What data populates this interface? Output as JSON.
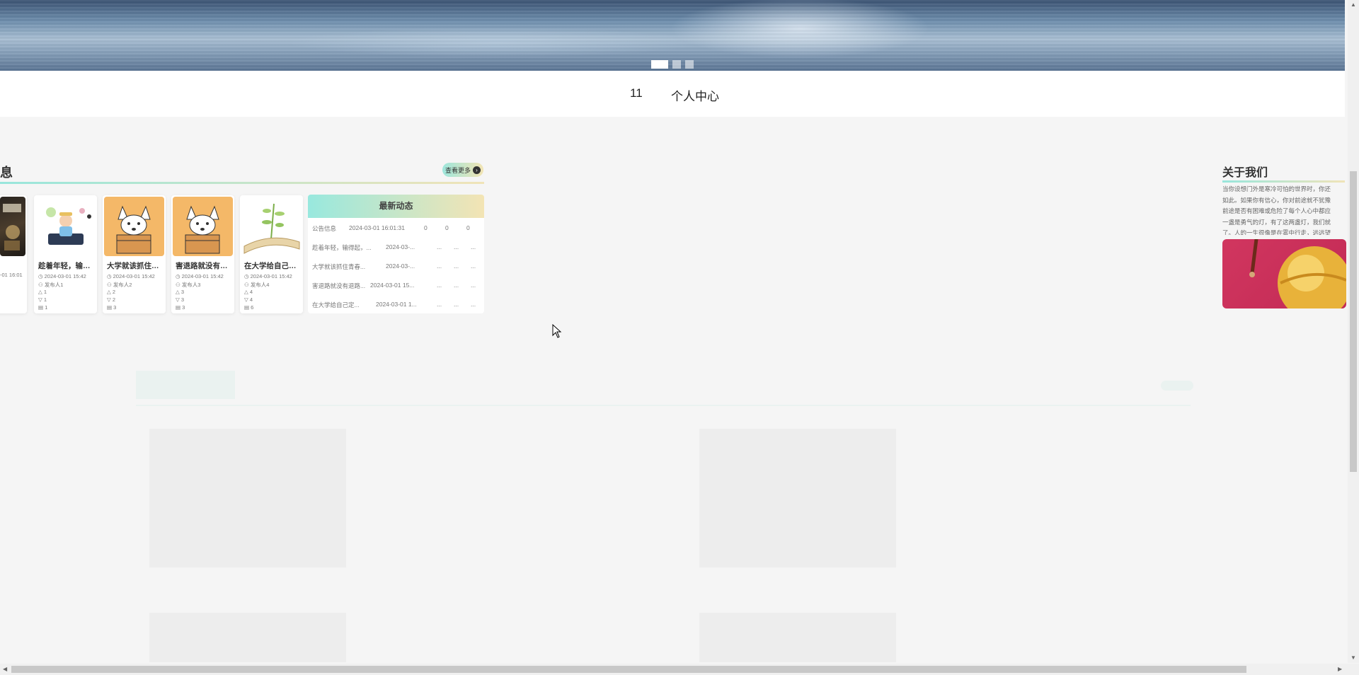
{
  "banner": {
    "slides": [
      "slide-1",
      "slide-2",
      "slide-3"
    ],
    "active_slide": 0
  },
  "nav": {
    "items": [
      {
        "label": "11"
      },
      {
        "label": "个人中心"
      }
    ]
  },
  "info_section": {
    "title": "息",
    "more_label": "查看更多",
    "cards": [
      {
        "title": "",
        "date": "-01 16:01",
        "author": "",
        "likes": "",
        "dislikes": "",
        "comments": ""
      },
      {
        "title": "趁着年轻，输得起，...",
        "date": "2024-03-01 15:42",
        "author": "发布人1",
        "likes": "1",
        "dislikes": "1",
        "comments": "1"
      },
      {
        "title": "大学就该抓住青春...",
        "date": "2024-03-01 15:42",
        "author": "发布人2",
        "likes": "2",
        "dislikes": "2",
        "comments": "3"
      },
      {
        "title": "害退路就没有退路...",
        "date": "2024-03-01 15:42",
        "author": "发布人3",
        "likes": "3",
        "dislikes": "3",
        "comments": "3"
      },
      {
        "title": "在大学给自己定...",
        "date": "2024-03-01 15:42",
        "author": "发布人4",
        "likes": "4",
        "dislikes": "4",
        "comments": "6"
      }
    ]
  },
  "latest": {
    "title": "最新动态",
    "rows": [
      {
        "title": "公告信息",
        "time": "2024-03-01 16:01:31",
        "likes": "0",
        "dislikes": "0",
        "comments": "0"
      },
      {
        "title": "趁着年轻，输得起，...",
        "time": "2024-03-...",
        "likes": "...",
        "dislikes": "...",
        "comments": "..."
      },
      {
        "title": "大学就该抓住青春...",
        "time": "2024-03-...",
        "likes": "...",
        "dislikes": "...",
        "comments": "..."
      },
      {
        "title": "害退路就没有退路...",
        "time": "2024-03-01 15...",
        "likes": "...",
        "dislikes": "...",
        "comments": "..."
      },
      {
        "title": "在大学给自己定...",
        "time": "2024-03-01 1...",
        "likes": "...",
        "dislikes": "...",
        "comments": "..."
      }
    ]
  },
  "about": {
    "title": "关于我们",
    "text": "当你设想门外是寒冷可怕的世界时，你还\n如此。如果你有信心，你对前途就不犹豫\n前途是否有困难或危险了每个人心中都应\n一盏是勇气的灯，有了这两盏灯，我们就\n了。人的一生很像是在雾中行走，远远望"
  },
  "colors": {
    "accent_from": "#98e6dc",
    "accent_to": "#f0e4b8",
    "about_image": "#d1365f"
  }
}
